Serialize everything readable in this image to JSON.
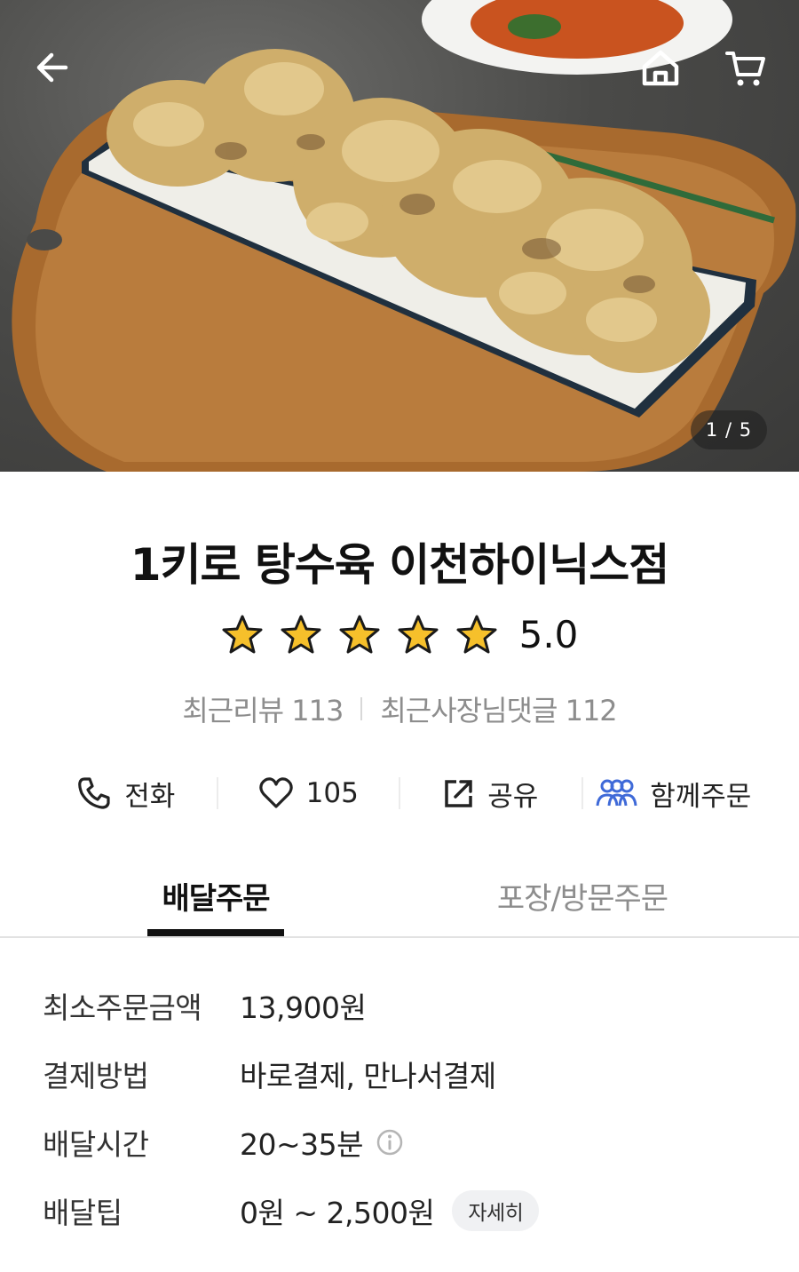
{
  "hero": {
    "image_counter": "1 / 5"
  },
  "store": {
    "name": "1키로 탕수육 이천하이닉스점",
    "rating": "5.0",
    "star_count": 5,
    "recent_reviews_label": "최근리뷰 113",
    "owner_comments_label": "최근사장님댓글 112"
  },
  "actions": {
    "call_label": "전화",
    "like_count": "105",
    "share_label": "공유",
    "group_order_label": "함께주문"
  },
  "tabs": [
    {
      "label": "배달주문",
      "active": true
    },
    {
      "label": "포장/방문주문",
      "active": false
    }
  ],
  "info": {
    "min_order": {
      "label": "최소주문금액",
      "value": "13,900원"
    },
    "payment": {
      "label": "결제방법",
      "value": "바로결제, 만나서결제"
    },
    "delivery_time": {
      "label": "배달시간",
      "value": "20~35분"
    },
    "delivery_tip": {
      "label": "배달팁",
      "value": "0원 ~ 2,500원",
      "detail_label": "자세히"
    }
  },
  "colors": {
    "star": "#f6c02b",
    "group_icon": "#3f6ad8",
    "muted_text": "#8d8d8d"
  }
}
